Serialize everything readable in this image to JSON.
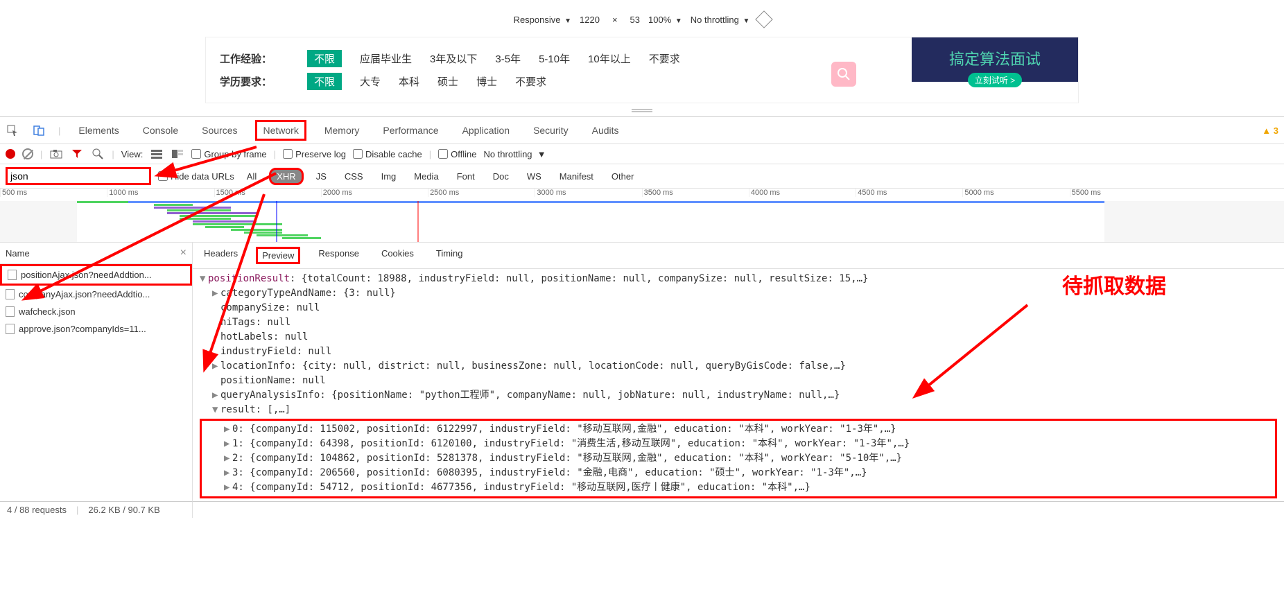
{
  "device_toolbar": {
    "mode": "Responsive",
    "width": "1220",
    "height": "53",
    "zoom": "100%",
    "throttling": "No throttling"
  },
  "page_content": {
    "filters": [
      {
        "label": "工作经验：",
        "options": [
          "不限",
          "应届毕业生",
          "3年及以下",
          "3-5年",
          "5-10年",
          "10年以上",
          "不要求"
        ]
      },
      {
        "label": "学历要求：",
        "options": [
          "不限",
          "大专",
          "本科",
          "硕士",
          "博士",
          "不要求"
        ]
      }
    ],
    "banner_text": "搞定算法面试",
    "banner_btn": "立刻试听 >"
  },
  "devtools": {
    "tabs": [
      "Elements",
      "Console",
      "Sources",
      "Network",
      "Memory",
      "Performance",
      "Application",
      "Security",
      "Audits"
    ],
    "active_tab": "Network",
    "warnings": "3",
    "toolbar": {
      "view_label": "View:",
      "group_by_frame": "Group by frame",
      "preserve_log": "Preserve log",
      "disable_cache": "Disable cache",
      "offline": "Offline",
      "throttling": "No throttling"
    },
    "filter": {
      "value": "json",
      "hide_data_urls": "Hide data URLs",
      "types": [
        "All",
        "XHR",
        "JS",
        "CSS",
        "Img",
        "Media",
        "Font",
        "Doc",
        "WS",
        "Manifest",
        "Other"
      ]
    },
    "timeline_ticks": [
      "500 ms",
      "1000 ms",
      "1500 ms",
      "2000 ms",
      "2500 ms",
      "3000 ms",
      "3500 ms",
      "4000 ms",
      "4500 ms",
      "5000 ms",
      "5500 ms"
    ],
    "requests_header": "Name",
    "requests": [
      "positionAjax.json?needAddtion...",
      "companyAjax.json?needAddtio...",
      "wafcheck.json",
      "approve.json?companyIds=11..."
    ],
    "detail_tabs": [
      "Headers",
      "Preview",
      "Response",
      "Cookies",
      "Timing"
    ],
    "preview_json": {
      "positionResult": "{totalCount: 18988, industryField: null, positionName: null, companySize: null, resultSize: 15,…}",
      "catTypeAndName": "categoryTypeAndName: {3: null}",
      "companySize": "companySize: null",
      "hiTags": "hiTags: null",
      "hotLabels": "hotLabels: null",
      "industryField": "industryField: null",
      "locationInfo": "locationInfo: {city: null, district: null, businessZone: null, locationCode: null, queryByGisCode: false,…}",
      "positionName": "positionName: null",
      "queryAnalysis": "queryAnalysisInfo: {positionName: \"python工程师\", companyName: null, jobNature: null, industryName: null,…}",
      "result_hdr": "result: [,…]",
      "rows": [
        "0: {companyId: 115002, positionId: 6122997, industryField: \"移动互联网,金融\", education: \"本科\", workYear: \"1-3年\",…}",
        "1: {companyId: 64398, positionId: 6120100, industryField: \"消费生活,移动互联网\", education: \"本科\", workYear: \"1-3年\",…}",
        "2: {companyId: 104862, positionId: 5281378, industryField: \"移动互联网,金融\", education: \"本科\", workYear: \"5-10年\",…}",
        "3: {companyId: 206560, positionId: 6080395, industryField: \"金融,电商\", education: \"硕士\", workYear: \"1-3年\",…}",
        "4: {companyId: 54712, positionId: 4677356, industryField: \"移动互联网,医疗丨健康\", education: \"本科\",…}"
      ]
    },
    "annotation": "待抓取数据",
    "status": {
      "requests": "4 / 88 requests",
      "size": "26.2 KB / 90.7 KB"
    }
  }
}
